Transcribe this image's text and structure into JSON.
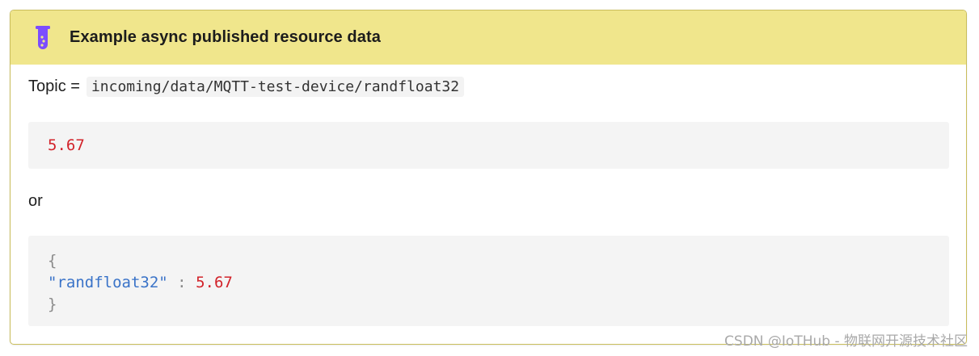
{
  "admonition": {
    "title": "Example async published resource data",
    "icon": "flask-icon",
    "header_color": "#f0e68c",
    "border_color": "#c9bd5b"
  },
  "topic": {
    "label": "Topic =",
    "value": "incoming/data/MQTT-test-device/randfloat32"
  },
  "example_plain": {
    "value": "5.67"
  },
  "separator": "or",
  "example_json": {
    "open_brace": "{",
    "key": "\"randfloat32\"",
    "colon": ":",
    "value": "5.67",
    "close_brace": "}"
  },
  "watermark": "CSDN @IoTHub - 物联网开源技术社区",
  "colors": {
    "number": "#d2232a",
    "string": "#3a73c8",
    "icon": "#7c4dff"
  }
}
